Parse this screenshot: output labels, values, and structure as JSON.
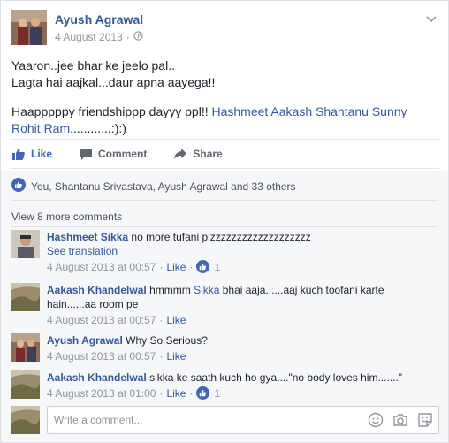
{
  "post": {
    "author": "Ayush Agrawal",
    "date": "4 August 2013",
    "separator": "·",
    "privacy_icon": "globe-icon",
    "lines": [
      "Yaaron..jee bhar ke jeelo pal..",
      "Lagta hai aajkal...daur apna aayega!!"
    ],
    "wish_text": "Haapppppy friendshippp dayyy ppl!! ",
    "mentions": "Hashmeet Aakash Shantanu Sunny Rohit Ram",
    "wish_tail": "............:):)"
  },
  "actions": {
    "like": "Like",
    "comment": "Comment",
    "share": "Share"
  },
  "likes_summary": "You, Shantanu Srivastava, Ayush Agrawal and 33 others",
  "view_more": "View 8 more comments",
  "comments": [
    {
      "name": "Hashmeet Sikka",
      "text": "no more tufani plzzzzzzzzzzzzzzzzzzz",
      "see_translation": "See translation",
      "time": "4 August 2013 at 00:57",
      "like": "Like",
      "likes": "1"
    },
    {
      "name": "Aakash Khandelwal",
      "text_a": "hmmmm ",
      "mention": "Sikka",
      "text_b": " bhai aaja......aaj kuch toofani karte hain......aa room pe",
      "time": "4 August 2013 at 00:57",
      "like": "Like"
    },
    {
      "name": "Ayush Agrawal",
      "text": "Why So Serious?",
      "time": "4 August 2013 at 00:57",
      "like": "Like"
    },
    {
      "name": "Aakash Khandelwal",
      "text": "sikka ke saath kuch ho gya....\"no body loves him.......\"",
      "time": "4 August 2013 at 01:00",
      "like": "Like",
      "likes": "1"
    }
  ],
  "composer": {
    "placeholder": "Write a comment...",
    "icons": [
      "emoji-icon",
      "camera-icon",
      "sticker-icon"
    ]
  },
  "colors": {
    "link": "#365899",
    "like_blue": "#4267b2",
    "muted": "#90949c",
    "comment_bg": "#f6f7f9"
  }
}
